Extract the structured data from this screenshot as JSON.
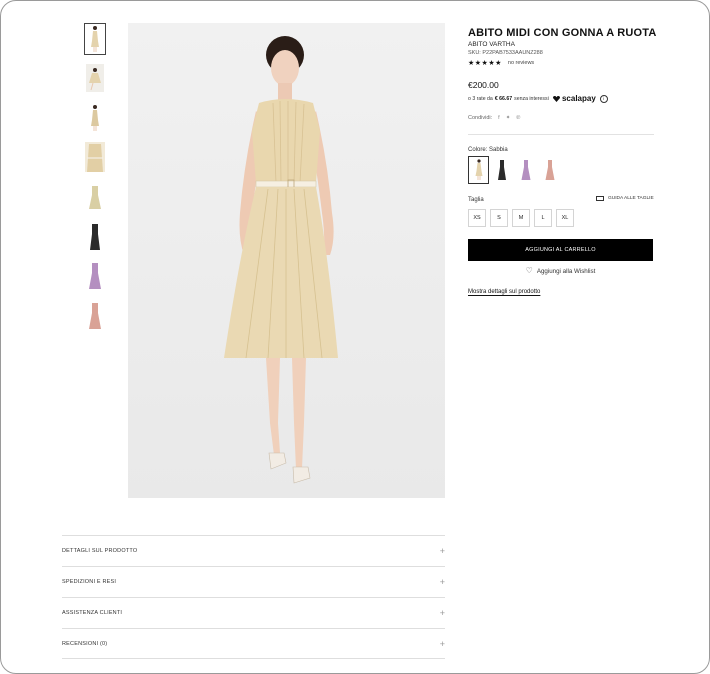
{
  "product": {
    "title": "ABITO MIDI CON GONNA A RUOTA",
    "subtitle": "ABITO VARTHA",
    "sku": "SKU:  P22PAB7533AAUNZ288",
    "stars": "★★★★★",
    "reviews": "no reviews",
    "price": "€200.00",
    "installments_prefix": "o 3 rate da",
    "installments_amount": "€ 66.67",
    "installments_suffix": "senza interessi",
    "scalapay": "scalapay",
    "info_glyph": "i"
  },
  "share": {
    "label": "Condividi:",
    "icons": [
      "facebook-icon",
      "twitter-icon",
      "pinterest-icon"
    ],
    "glyphs": [
      "f",
      "✦",
      "℗"
    ]
  },
  "color": {
    "label": "Colore: Sabbia"
  },
  "size": {
    "label": "Taglia",
    "guide_label": "GUIDA ALLE TAGLIE",
    "options": [
      "XS",
      "S",
      "M",
      "L",
      "XL"
    ]
  },
  "actions": {
    "add_to_cart": "AGGIUNGI AL CARRELLO",
    "wishlist": "Aggiungi alla Wishlist",
    "heart_glyph": "♡",
    "details_link": "Mostra dettagli sul prodotto"
  },
  "accordion": {
    "items": [
      "DETTAGLI SUL PRODOTTO",
      "SPEDIZIONI E RESI",
      "ASSISTENZA CLIENTI",
      "RECENSIONI (0)"
    ],
    "plus_glyph": "+"
  },
  "colors": {
    "sabbia": "#e4d3ad",
    "nero": "#2b2b2b",
    "lilla": "#b48fc0",
    "rosa": "#d9a296",
    "accent": "#000000"
  }
}
